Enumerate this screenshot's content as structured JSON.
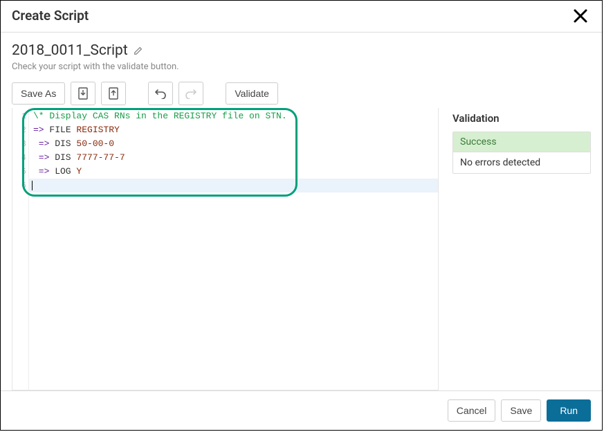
{
  "header": {
    "title": "Create Script",
    "close_aria": "close"
  },
  "script": {
    "name": "2018_0011_Script",
    "hint": "Check your script with the validate button."
  },
  "toolbar": {
    "save_as_label": "Save As",
    "validate_label": "Validate"
  },
  "code_lines": [
    {
      "n": 1,
      "raw": "\\* Display CAS RNs in the REGISTRY file on STN.",
      "type": "comment"
    },
    {
      "n": 2,
      "raw": "=> FILE REGISTRY",
      "indent": 0,
      "cmd": "FILE",
      "arg": "REGISTRY"
    },
    {
      "n": 3,
      "raw": " => DIS 50-00-0",
      "indent": 1,
      "cmd": "DIS",
      "arg": "50-00-0"
    },
    {
      "n": 4,
      "raw": " => DIS 7777-77-7",
      "indent": 1,
      "cmd": "DIS",
      "arg": "7777-77-7"
    },
    {
      "n": 5,
      "raw": " => LOG Y",
      "indent": 1,
      "cmd": "LOG",
      "arg": "Y"
    },
    {
      "n": 6,
      "raw": "",
      "type": "empty",
      "active": true
    }
  ],
  "highlight": {
    "visible": true
  },
  "validation": {
    "section_title": "Validation",
    "status": "Success",
    "message": "No errors detected"
  },
  "footer": {
    "cancel_label": "Cancel",
    "save_label": "Save",
    "run_label": "Run"
  }
}
